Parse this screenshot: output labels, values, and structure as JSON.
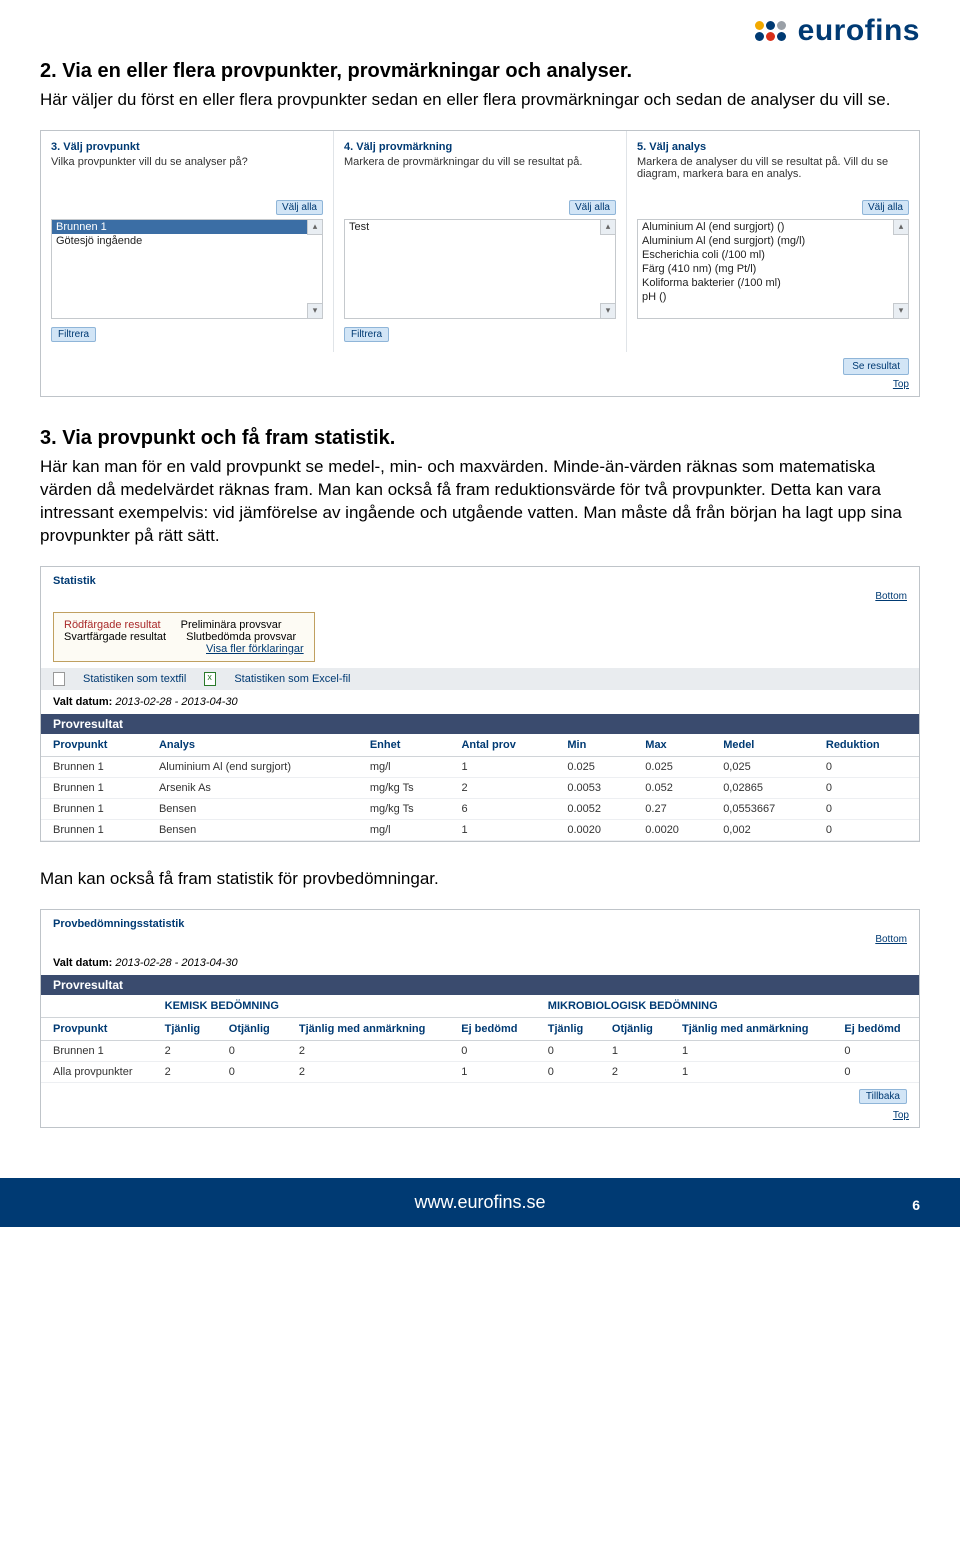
{
  "logo": {
    "text": "eurofins"
  },
  "sec2": {
    "title": "2. Via en eller flera provpunkter, provmärkningar och analyser.",
    "desc": "Här väljer du först en eller flera provpunkter sedan en eller flera provmärkningar och sedan de analyser du vill se."
  },
  "shot1": {
    "col3": {
      "head": "3. Välj provpunkt",
      "sub": "Vilka provpunkter vill du se analyser på?",
      "btn": "Välj alla",
      "items": [
        "Brunnen 1",
        "Götesjö ingående"
      ],
      "filtrera": "Filtrera"
    },
    "col4": {
      "head": "4. Välj provmärkning",
      "sub": "Markera de provmärkningar du vill se resultat på.",
      "btn": "Välj alla",
      "items": [
        "Test"
      ],
      "filtrera": "Filtrera"
    },
    "col5": {
      "head": "5. Välj analys",
      "sub": "Markera de analyser du vill se resultat på. Vill du se diagram, markera bara en analys.",
      "btn": "Välj alla",
      "items": [
        "Aluminium Al (end surgjort) ()",
        "Aluminium Al (end surgjort) (mg/l)",
        "Escherichia coli (/100 ml)",
        "Färg (410 nm) (mg Pt/l)",
        "Koliforma bakterier (/100 ml)",
        "pH ()"
      ]
    },
    "seresultat": "Se resultat",
    "top": "Top"
  },
  "sec3": {
    "title": "3. Via provpunkt och få fram statistik.",
    "desc": "Här kan man för en vald provpunkt se medel-, min- och maxvärden. Minde-än-värden räknas som matematiska värden då medelvärdet räknas fram. Man kan också få fram reduktionsvärde för två provpunkter. Detta kan vara intressant exempelvis: vid jämförelse av ingående och utgående vatten. Man måste då från början ha lagt upp sina provpunkter på rätt sätt."
  },
  "shot2": {
    "head": "Statistik",
    "bottom": "Bottom",
    "legend": {
      "r1l": "Rödfärgade resultat",
      "r1r": "Preliminära provsvar",
      "r2l": "Svartfärgade resultat",
      "r2r": "Slutbedömda provsvar",
      "more": "Visa fler förklaringar"
    },
    "bar": {
      "txt": "Statistiken som textfil",
      "xls": "Statistiken som Excel-fil"
    },
    "valt_label": "Valt datum:",
    "valt": "2013-02-28 - 2013-04-30",
    "provresultat": "Provresultat",
    "cols": [
      "Provpunkt",
      "Analys",
      "Enhet",
      "Antal prov",
      "Min",
      "Max",
      "Medel",
      "Reduktion"
    ],
    "rows": [
      [
        "Brunnen 1",
        "Aluminium Al (end surgjort)",
        "mg/l",
        "1",
        "0.025",
        "0.025",
        "0,025",
        "0"
      ],
      [
        "Brunnen 1",
        "Arsenik As",
        "mg/kg Ts",
        "2",
        "0.0053",
        "0.052",
        "0,02865",
        "0"
      ],
      [
        "Brunnen 1",
        "Bensen",
        "mg/kg Ts",
        "6",
        "0.0052",
        "0.27",
        "0,0553667",
        "0"
      ],
      [
        "Brunnen 1",
        "Bensen",
        "mg/l",
        "1",
        "0.0020",
        "0.0020",
        "0,002",
        "0"
      ]
    ]
  },
  "sec4": {
    "line": "Man kan också få fram statistik för provbedömningar."
  },
  "shot3": {
    "head": "Provbedömningsstatistik",
    "bottom": "Bottom",
    "valt_label": "Valt datum:",
    "valt": "2013-02-28 - 2013-04-30",
    "provresultat": "Provresultat",
    "group1": "KEMISK BEDÖMNING",
    "group2": "MIKROBIOLOGISK BEDÖMNING",
    "cols": [
      "Provpunkt",
      "Tjänlig",
      "Otjänlig",
      "Tjänlig med anmärkning",
      "Ej bedömd",
      "Tjänlig",
      "Otjänlig",
      "Tjänlig med anmärkning",
      "Ej bedömd"
    ],
    "rows": [
      [
        "Brunnen 1",
        "2",
        "0",
        "2",
        "0",
        "0",
        "1",
        "1",
        "0"
      ],
      [
        "Alla provpunkter",
        "2",
        "0",
        "2",
        "1",
        "0",
        "2",
        "1",
        "0"
      ]
    ],
    "tillbaka": "Tillbaka",
    "top": "Top"
  },
  "footer": {
    "url": "www.eurofins.se",
    "page": "6"
  }
}
